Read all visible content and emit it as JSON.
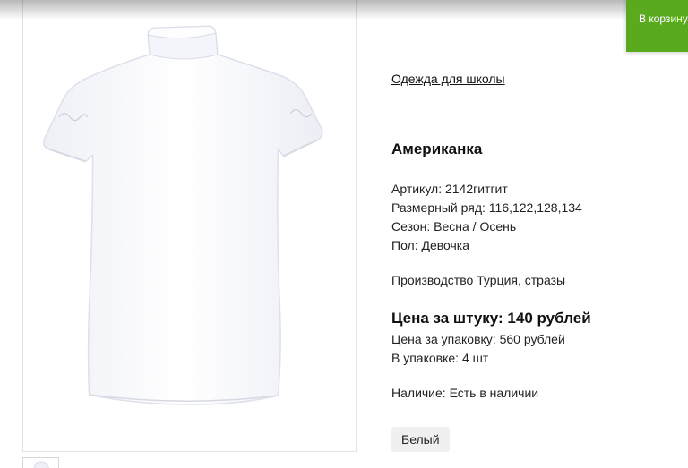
{
  "cart_toast": {
    "text": "В корзину"
  },
  "product": {
    "category_link": "Одежда для школы",
    "title": "Американка",
    "specs": [
      "Артикул: 2142гитгит",
      "Размерный ряд: 116,122,128,134",
      "Сезон: Весна / Осень",
      "Пол: Девочка"
    ],
    "origin": "Производство Турция, стразы",
    "price_unit": "Цена за штуку: 140 рублей",
    "price_pack": "Цена за упаковку: 560 рублей",
    "pack_count": "В упаковке: 4 шт",
    "availability": "Наличие: Есть в наличии",
    "color_option": "Белый"
  },
  "colors": {
    "accent_green": "#5aaa1e",
    "divider": "#e6e6e6",
    "chip_bg": "#f0f0f0"
  }
}
